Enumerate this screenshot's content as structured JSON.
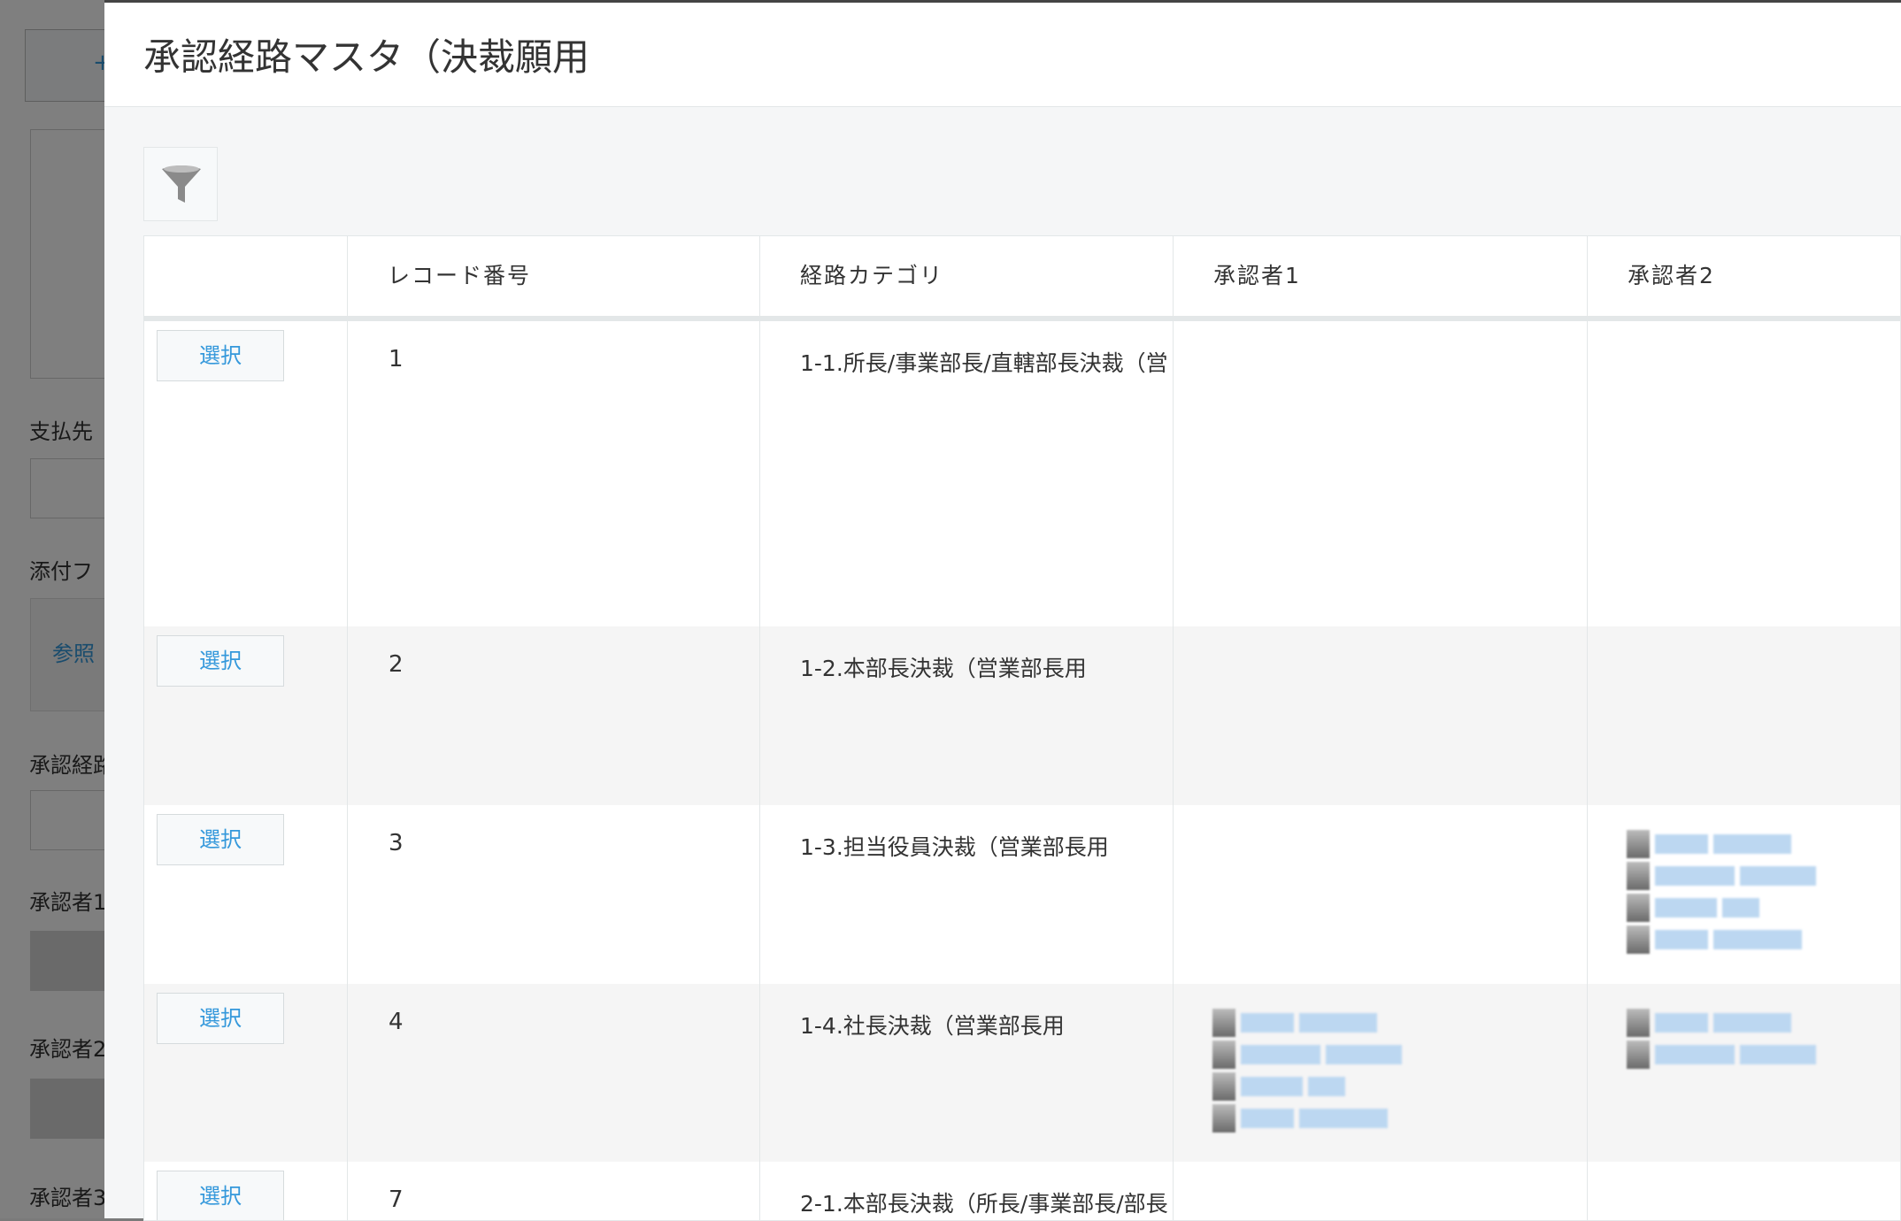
{
  "background_form": {
    "labels": [
      "支払先",
      "添付フ",
      "承認経路",
      "承認者1",
      "承認者2",
      "承認者3"
    ],
    "top_button_glyph": "+",
    "attach_button": "参照"
  },
  "dialog": {
    "title": "承認経路マスタ（決裁願用",
    "filter_icon": "filter-funnel-icon"
  },
  "table": {
    "columns": [
      "",
      "レコード番号",
      "経路カテゴリ",
      "承認者1",
      "承認者2"
    ],
    "select_label": "選択",
    "rows": [
      {
        "record_no": "1",
        "category": "1-1.所長/事業部長/直轄部長決裁（営",
        "approver1_count": 0,
        "approver2_count": 0
      },
      {
        "record_no": "2",
        "category": "1-2.本部長決裁（営業部長用",
        "approver1_count": 0,
        "approver2_count": 0
      },
      {
        "record_no": "3",
        "category": "1-3.担当役員決裁（営業部長用",
        "approver1_count": 0,
        "approver2_count": 4
      },
      {
        "record_no": "4",
        "category": "1-4.社長決裁（営業部長用",
        "approver1_count": 4,
        "approver2_count": 2
      },
      {
        "record_no": "7",
        "category": "2-1.本部長決裁（所長/事業部長/部長",
        "approver1_count": 0,
        "approver2_count": 0
      }
    ]
  },
  "colors": {
    "accent": "#3498db",
    "border": "#e3e7e8",
    "row_alt": "#f5f5f5"
  }
}
